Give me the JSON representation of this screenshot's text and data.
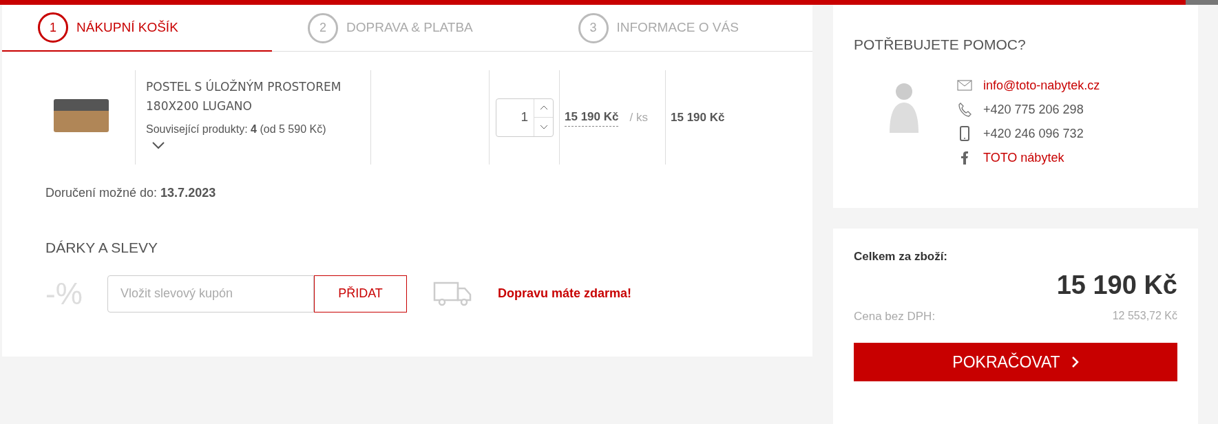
{
  "steps": [
    {
      "number": "1",
      "label": "NÁKUPNÍ KOŠÍK",
      "selected": true
    },
    {
      "number": "2",
      "label": "DOPRAVA & PLATBA",
      "selected": false
    },
    {
      "number": "3",
      "label": "INFORMACE O VÁS",
      "selected": false
    }
  ],
  "cart_item": {
    "name": "POSTEL S ÚLOŽNÝM PROSTOREM 180X200 LUGANO",
    "related": "Související produkty: **4** (od 5 590 Kč)",
    "quantity": "1",
    "unit_price": "15 190 Kč",
    "unit": "/ ks",
    "total": "15 190 Kč"
  },
  "delivery": "Doručení možné do: **13.7.2023**",
  "gifts": {
    "title": "DÁRKY A SLEVY",
    "percent_sign": "-%",
    "placeholder": "Vložit slevový kupón",
    "button": "PŘIDAT",
    "free_shipping": "Dopravu máte zdarma!"
  },
  "help": {
    "title": "POTŘEBUJETE POMOC?",
    "contacts": [
      {
        "kind": "email",
        "text": "info@toto-nabytek.cz"
      },
      {
        "kind": "phone",
        "text": "+420 775 206 298"
      },
      {
        "kind": "mobile",
        "text": "+420 246 096 732"
      },
      {
        "kind": "facebook",
        "text": "TOTO nábytek"
      }
    ]
  },
  "summary": {
    "label": "Celkem za zboží:",
    "total": "15 190 Kč",
    "net_label": "Cena bez DPH:",
    "net_value": "12 553,72 Kč",
    "button": "POKRAČOVAT"
  }
}
